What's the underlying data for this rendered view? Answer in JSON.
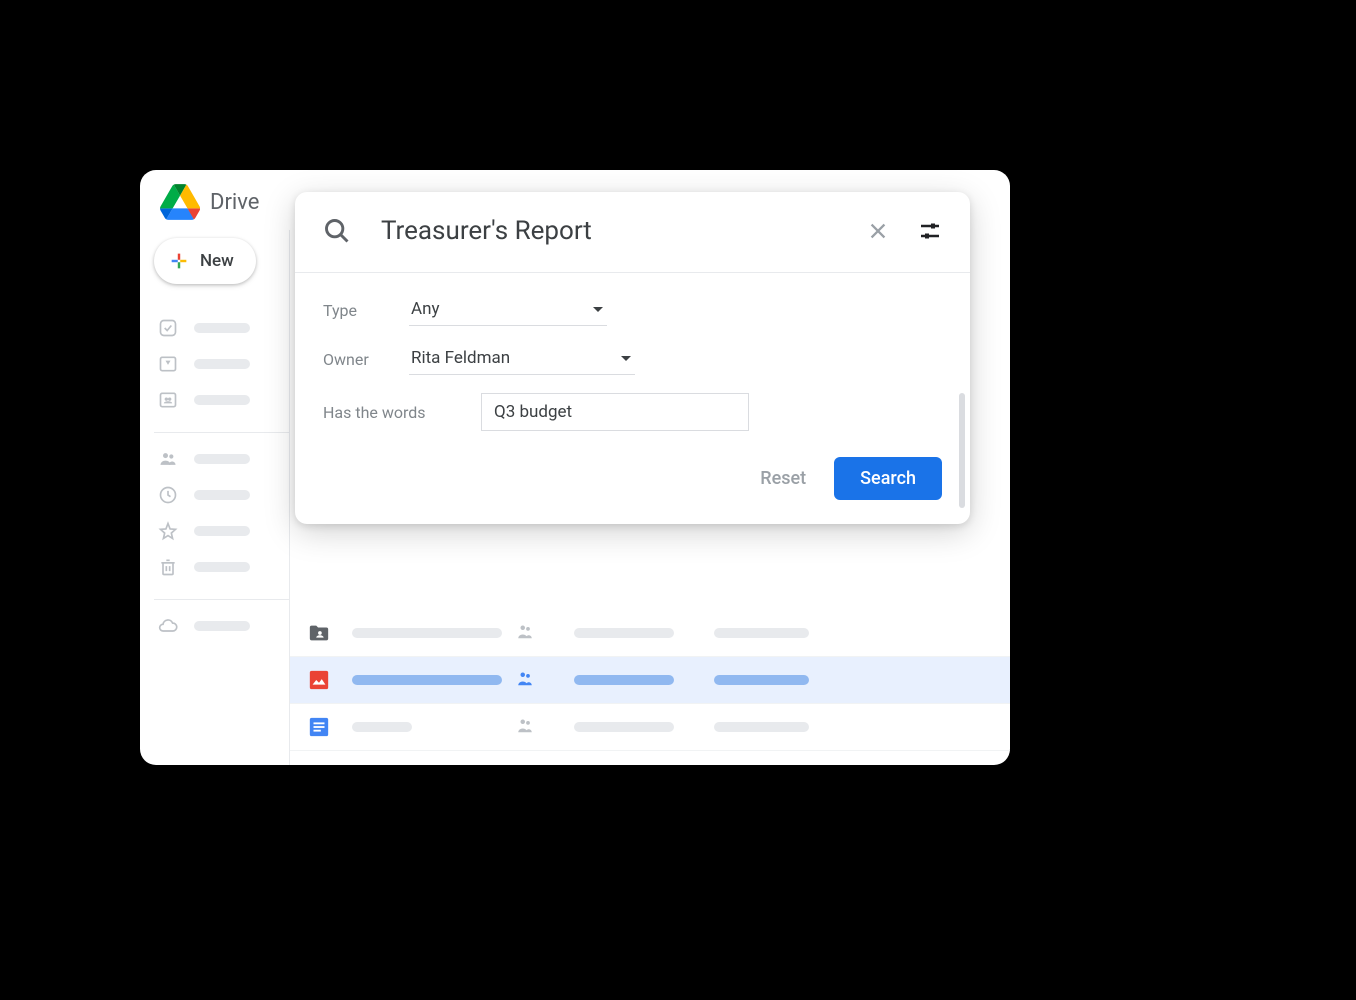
{
  "app": {
    "title": "Drive"
  },
  "sidebar": {
    "new_button": "New"
  },
  "search": {
    "query": "Treasurer's Report",
    "type_label": "Type",
    "type_value": "Any",
    "owner_label": "Owner",
    "owner_value": "Rita Feldman",
    "words_label": "Has the words",
    "words_value": "Q3 budget",
    "reset_label": "Reset",
    "search_label": "Search"
  },
  "colors": {
    "accent": "#1a73e8"
  }
}
